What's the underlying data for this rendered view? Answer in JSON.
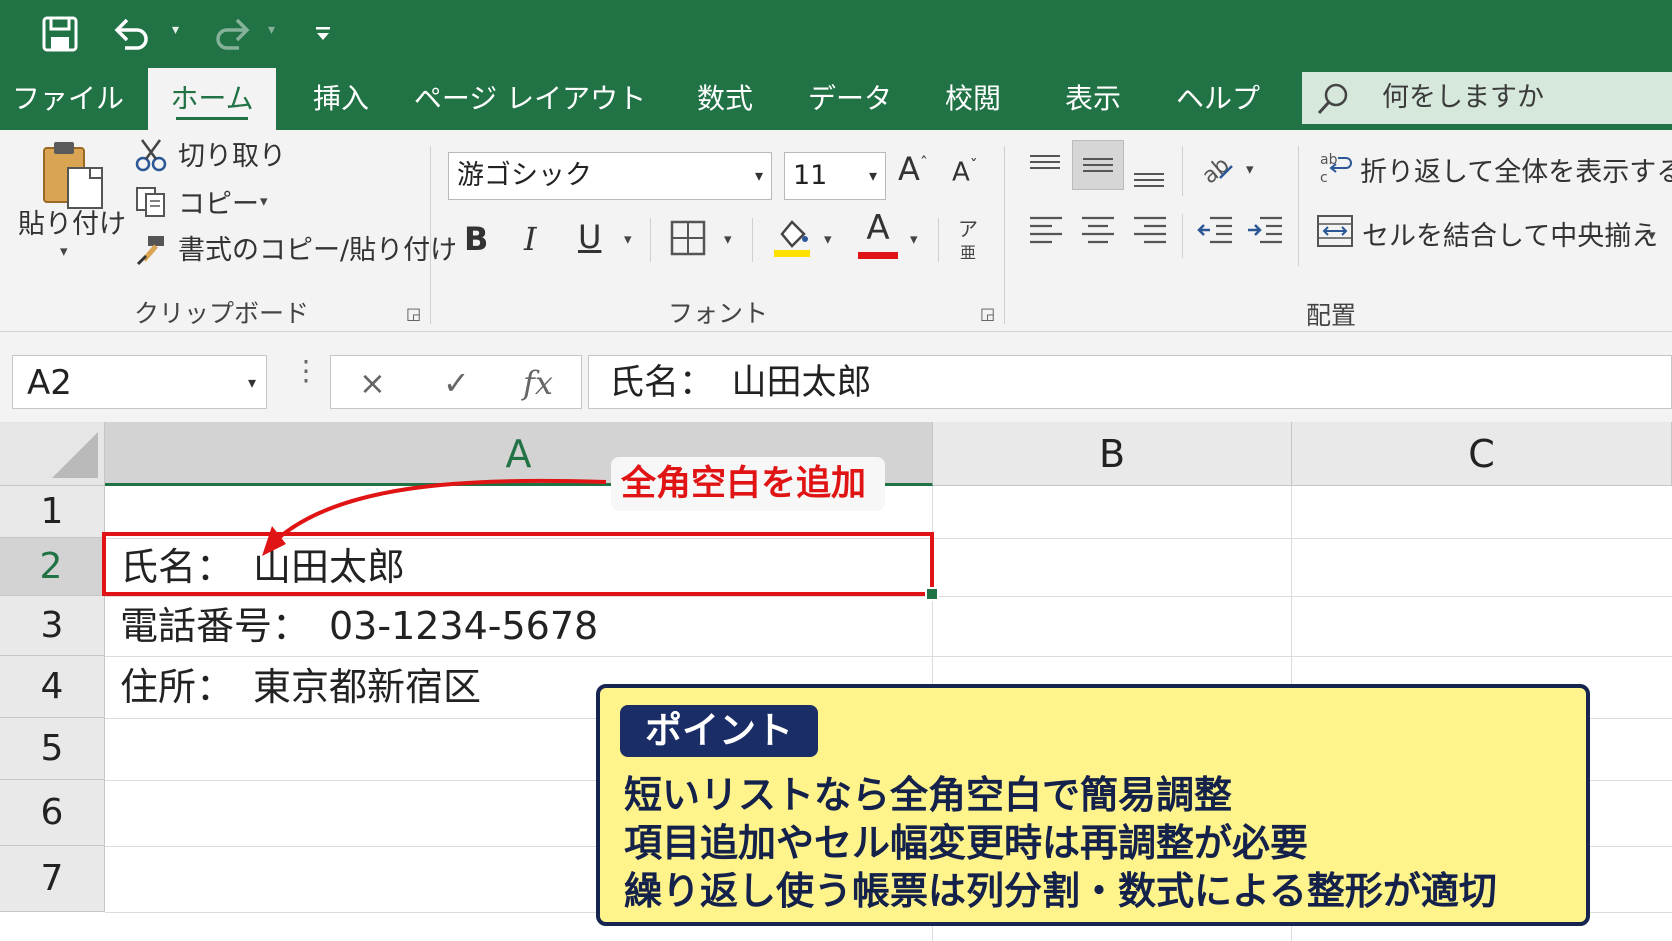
{
  "colors": {
    "excel_green": "#217346",
    "ribbon_bg": "#f3f3f3",
    "highlight_red": "#e01414",
    "point_bg": "#fff48c",
    "point_border": "#16254f",
    "point_badge": "#1b2d66"
  },
  "quick_access": {
    "icons": [
      "save-icon",
      "undo-icon",
      "redo-icon",
      "customize-icon"
    ]
  },
  "tabs": [
    {
      "label": "ファイル"
    },
    {
      "label": "ホーム",
      "active": true
    },
    {
      "label": "挿入"
    },
    {
      "label": "ページ レイアウト"
    },
    {
      "label": "数式"
    },
    {
      "label": "データ"
    },
    {
      "label": "校閲"
    },
    {
      "label": "表示"
    },
    {
      "label": "ヘルプ"
    }
  ],
  "search": {
    "placeholder": "何をしますか"
  },
  "clipboard": {
    "paste": "貼り付け",
    "cut": "切り取り",
    "copy": "コピー",
    "format_painter": "書式のコピー/貼り付け",
    "group_name": "クリップボード"
  },
  "font": {
    "font_name": "游ゴシック",
    "font_size": "11",
    "grow": "A",
    "shrink": "A",
    "bold": "B",
    "italic": "I",
    "underline": "U",
    "font_color_letter": "A",
    "phonetic": "ア",
    "group_name": "フォント"
  },
  "alignment": {
    "wrap_text": "折り返して全体を表示する",
    "merge_center": "セルを結合して中央揃え",
    "group_name": "配置"
  },
  "formula_bar": {
    "name_box": "A2",
    "cancel": "×",
    "enter": "✓",
    "fx": "fx",
    "content": "氏名：　山田太郎"
  },
  "sheet": {
    "columns": [
      "A",
      "B",
      "C"
    ],
    "rows": [
      "1",
      "2",
      "3",
      "4",
      "5",
      "6",
      "7"
    ],
    "cells": {
      "A2": "氏名：　山田太郎",
      "A3": "電話番号：　03-1234-5678",
      "A4": "住所：　東京都新宿区"
    },
    "selected_cell": "A2"
  },
  "annotation": {
    "callout": "全角空白を追加"
  },
  "point_box": {
    "badge": "ポイント",
    "lines": [
      "短いリストなら全角空白で簡易調整",
      "項目追加やセル幅変更時は再調整が必要",
      "繰り返し使う帳票は列分割・数式による整形が適切"
    ]
  }
}
